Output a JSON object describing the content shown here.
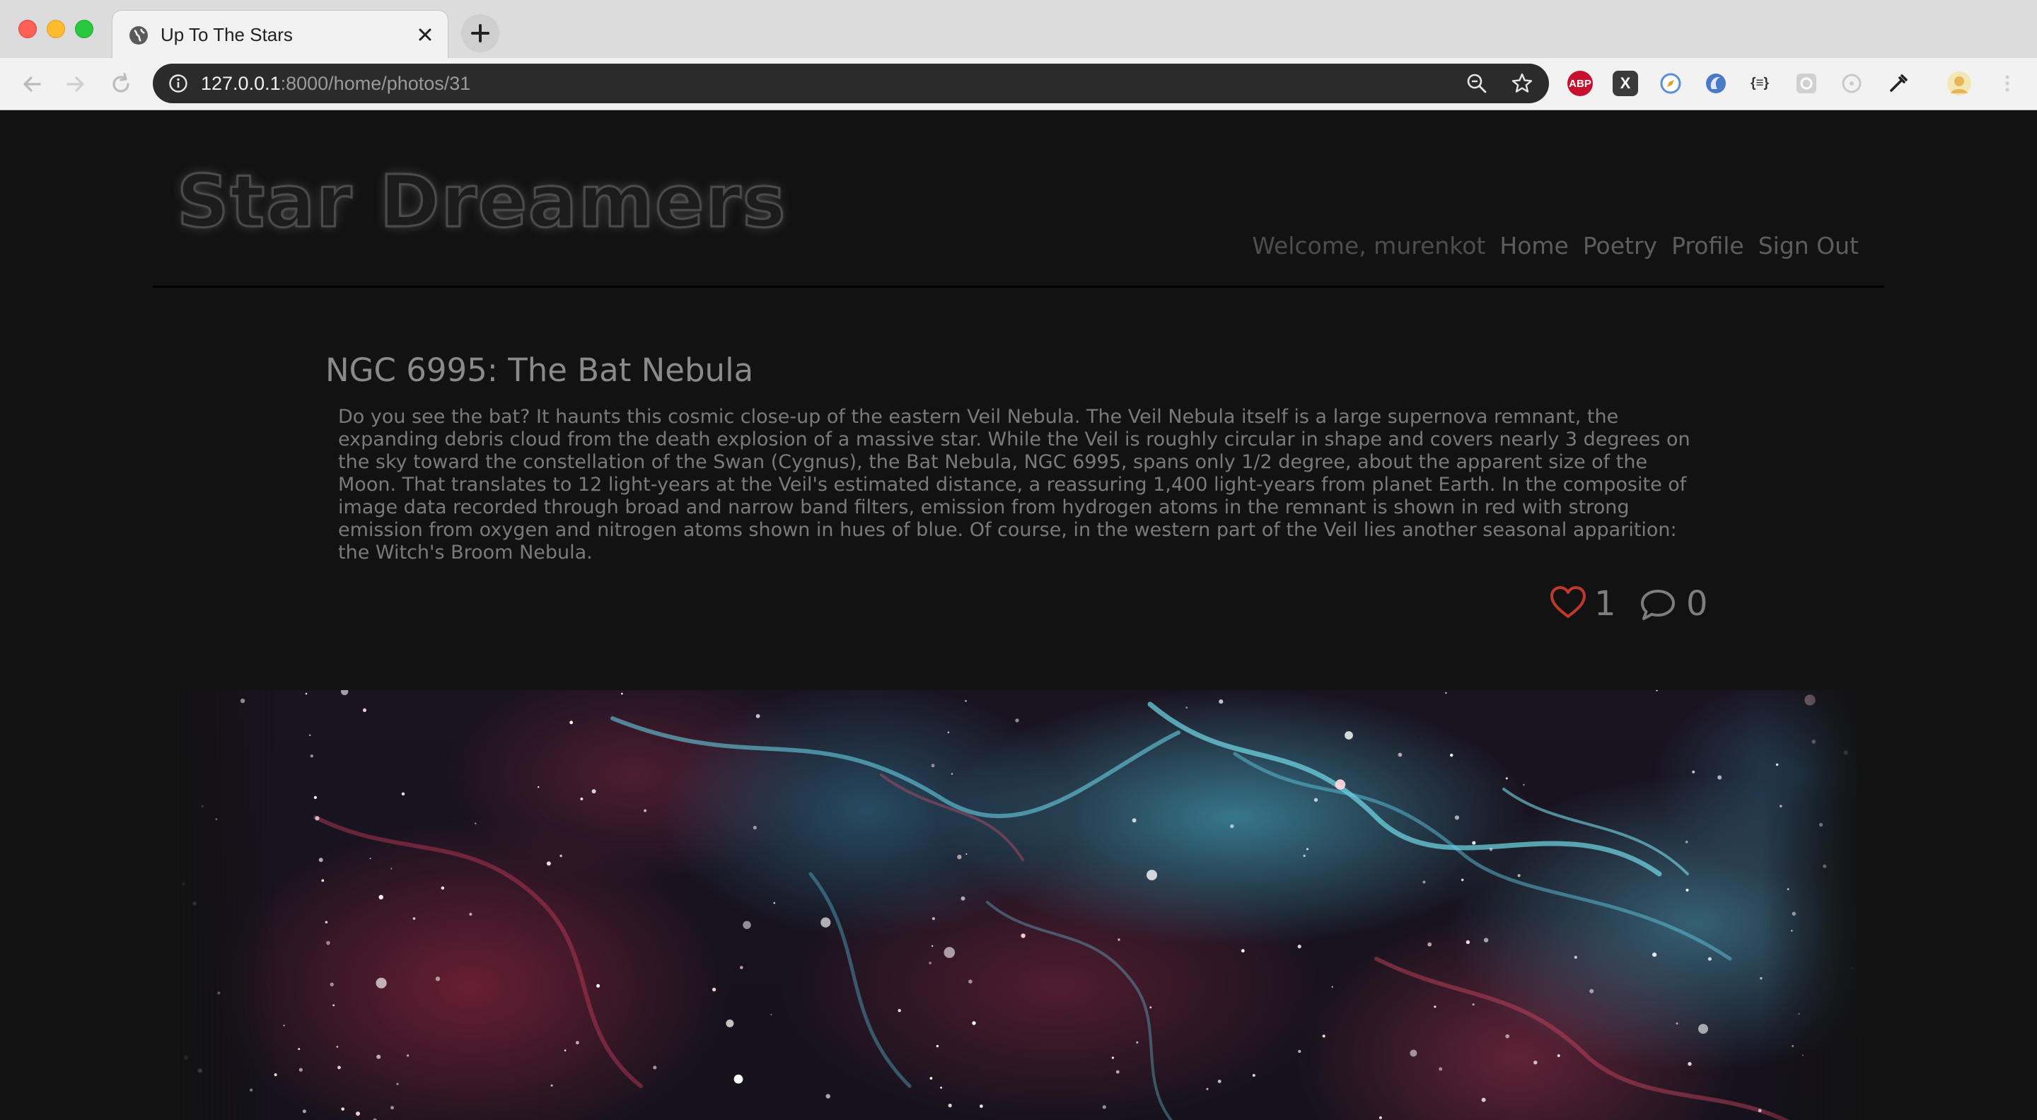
{
  "browser": {
    "tab_title": "Up To The Stars",
    "url_host": "127.0.0.1",
    "url_rest": ":8000/home/photos/31",
    "extensions": [
      "ABP",
      "X",
      "{≡}"
    ]
  },
  "site": {
    "brand": "Star Dreamers",
    "welcome": "Welcome, murenkot",
    "nav": [
      "Home",
      "Poetry",
      "Profile",
      "Sign Out"
    ]
  },
  "photo": {
    "title": "NGC 6995: The Bat Nebula",
    "description": "Do you see the bat? It haunts this cosmic close-up of the eastern Veil Nebula. The Veil Nebula itself is a large supernova remnant, the expanding debris cloud from the death explosion of a massive star. While the Veil is roughly circular in shape and covers nearly 3 degrees on the sky toward the constellation of the Swan (Cygnus), the Bat Nebula, NGC 6995, spans only 1/2 degree, about the apparent size of the Moon. That translates to 12 light-years at the Veil's estimated distance, a reassuring 1,400 light-years from planet Earth. In the composite of image data recorded through broad and narrow band filters, emission from hydrogen atoms in the remnant is shown in red with strong emission from oxygen and nitrogen atoms shown in hues of blue. Of course, in the western part of the Veil lies another seasonal apparition: the Witch's Broom Nebula.",
    "likes": "1",
    "comments": "0",
    "image_icon": "nebula-photo"
  },
  "colors": {
    "heart": "#c0392b",
    "page_bg": "#121212",
    "nav_text": "#5d5d5d"
  }
}
